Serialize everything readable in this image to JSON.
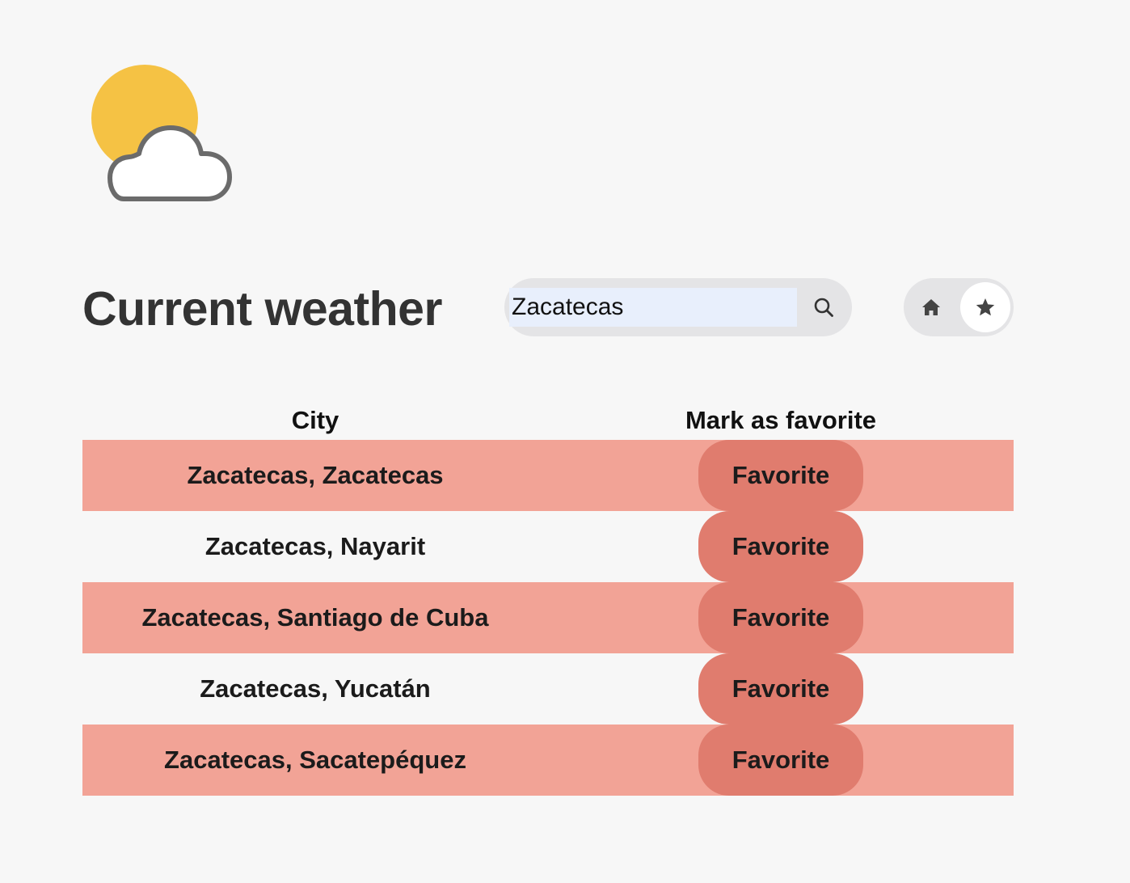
{
  "logo": {
    "icon": "partly-cloudy-icon",
    "sun_color": "#f5c244",
    "cloud_color": "#ffffff",
    "cloud_outline": "#6b6b6b"
  },
  "header": {
    "title": "Current weather"
  },
  "search": {
    "value": "Zacatecas",
    "placeholder": "",
    "icon": "search-icon"
  },
  "toggle": {
    "home_icon": "home-icon",
    "favorites_icon": "star-icon",
    "active": "favorites"
  },
  "table": {
    "headers": [
      "City",
      "Mark as favorite"
    ],
    "rows": [
      {
        "city": "Zacatecas, Zacatecas",
        "action": "Favorite"
      },
      {
        "city": "Zacatecas, Nayarit",
        "action": "Favorite"
      },
      {
        "city": "Zacatecas, Santiago de Cuba",
        "action": "Favorite"
      },
      {
        "city": "Zacatecas, Yucatán",
        "action": "Favorite"
      },
      {
        "city": "Zacatecas, Sacatepéquez",
        "action": "Favorite"
      }
    ]
  },
  "colors": {
    "background": "#f7f7f7",
    "row_highlight": "#f2a396",
    "button": "#e07c6e",
    "control_bg": "#e4e4e6"
  }
}
